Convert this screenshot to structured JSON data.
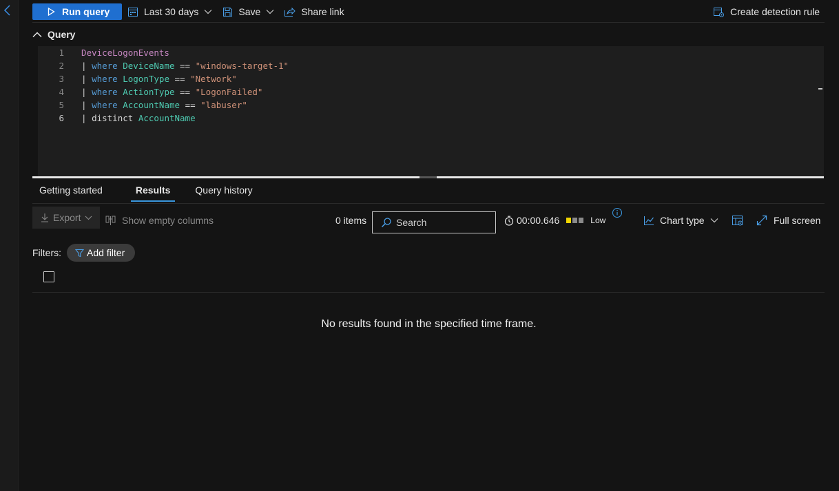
{
  "toolbar": {
    "run_label": "Run query",
    "timerange_label": "Last 30 days",
    "save_label": "Save",
    "share_label": "Share link",
    "detection_label": "Create detection rule"
  },
  "query": {
    "header_label": "Query",
    "lines": [
      {
        "num": "1",
        "table": "DeviceLogonEvents"
      },
      {
        "num": "2",
        "pipe": "|",
        "kw": "where",
        "col": "DeviceName",
        "op": "==",
        "str": "\"windows-target-1\""
      },
      {
        "num": "3",
        "pipe": "|",
        "kw": "where",
        "col": "LogonType",
        "op": "==",
        "str": "\"Network\""
      },
      {
        "num": "4",
        "pipe": "|",
        "kw": "where",
        "col": "ActionType",
        "op": "==",
        "str": "\"LogonFailed\""
      },
      {
        "num": "5",
        "pipe": "|",
        "kw": "where",
        "col": "AccountName",
        "op": "==",
        "str": "\"labuser\""
      },
      {
        "num": "6",
        "pipe": "|",
        "kw": "distinct",
        "col": "AccountName"
      }
    ]
  },
  "tabs": [
    {
      "label": "Getting started"
    },
    {
      "label": "Results",
      "active": true
    },
    {
      "label": "Query history"
    }
  ],
  "results": {
    "export_label": "Export",
    "show_empty_label": "Show empty columns",
    "items_count": "0 items",
    "search_placeholder": "Search",
    "elapsed": "00:00.646",
    "resource_usage": "Low",
    "chart_type_label": "Chart type",
    "fullscreen_label": "Full screen",
    "filters_label": "Filters:",
    "add_filter_label": "Add filter",
    "empty_message": "No results found in the specified time frame."
  },
  "colors": {
    "accent": "#1f6fd0",
    "usage_low": "#f2d600",
    "usage_off": "#8a8a8a"
  }
}
